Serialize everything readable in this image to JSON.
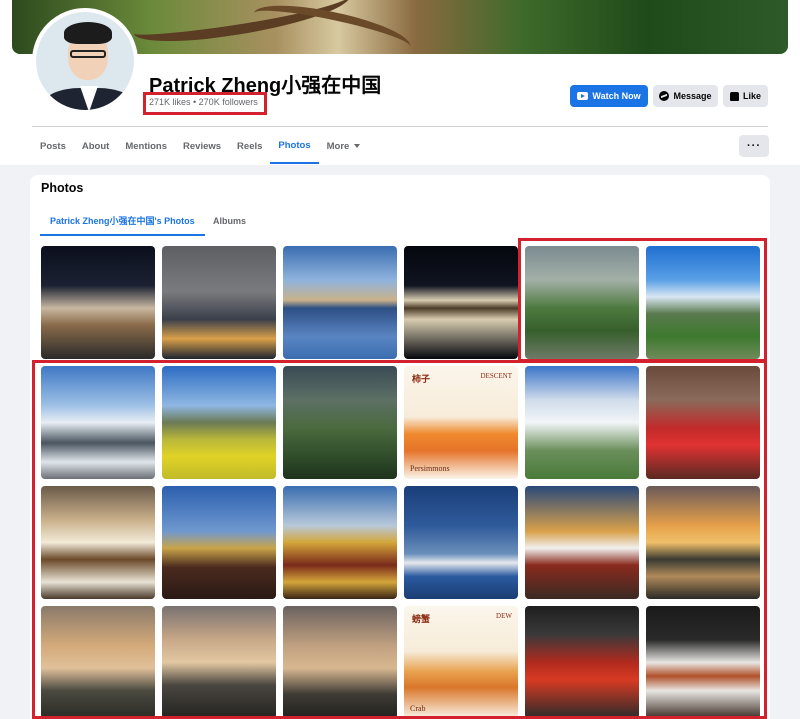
{
  "page": {
    "name": "Patrick Zheng小强在中国",
    "stats": "271K likes • 270K followers"
  },
  "actions": {
    "watch_label": "Watch Now",
    "message_label": "Message",
    "like_label": "Like"
  },
  "nav": {
    "tabs": [
      "Posts",
      "About",
      "Mentions",
      "Reviews",
      "Reels",
      "Photos",
      "More"
    ],
    "active": "Photos",
    "overflow_label": "···"
  },
  "photos": {
    "title": "Photos",
    "subtabs": [
      "Patrick Zheng小强在中国's Photos",
      "Albums"
    ],
    "items": [
      {
        "name": "potala-night-couple",
        "bg": "linear-gradient(180deg,#0b0f1c 0%,#1c2233 35%,#c8b8a0 55%,#8a6b4a 70%,#2a2a2a 100%)"
      },
      {
        "name": "city-skyline-night",
        "bg": "linear-gradient(180deg,#5e5f63 0%,#7a7b7e 40%,#3a3f4a 65%,#d9a04a 82%,#1e2430 100%)"
      },
      {
        "name": "person-sitting-reflection",
        "bg": "linear-gradient(180deg,#3a6db0 0%,#8fb3dd 30%,#c9b28a 48%,#2d4f84 55%,#5a85c2 80%,#3a6db0 100%)"
      },
      {
        "name": "potala-night-reflection",
        "bg": "linear-gradient(180deg,#05070d 0%,#0f1420 35%,#d8ccb0 48%,#4a3a28 55%,#d8ccb0 65%,#05070d 100%)"
      },
      {
        "name": "rainbow-valley",
        "bg": "linear-gradient(180deg,#7b8b8f 0%,#a3b0a8 30%,#4d7a3e 55%,#375f2c 75%,#6f7a68 100%)"
      },
      {
        "name": "mountain-village-blue-sky",
        "bg": "linear-gradient(180deg,#1f6fd1 0%,#5aa0e6 30%,#d8e6f2 45%,#5a7a4e 60%,#3d7a2e 80%,#6f8a5a 100%)"
      },
      {
        "name": "snowy-mountains",
        "bg": "linear-gradient(180deg,#3f78c4 0%,#9ec1e6 35%,#e8eef4 50%,#4a5560 68%,#dfe5ea 85%,#6a6f75 100%)"
      },
      {
        "name": "rapeseed-fields",
        "bg": "linear-gradient(180deg,#2d6cc4 0%,#8fb7e2 35%,#6b7a55 50%,#b9b83a 65%,#e0d226 80%,#c2bb2a 100%)"
      },
      {
        "name": "green-valley-clouds",
        "bg": "linear-gradient(180deg,#3a4a55 0%,#5c7065 30%,#4a6a3e 55%,#2f4d2a 80%,#1e331c 100%)"
      },
      {
        "name": "persimmons-poster",
        "bg": "linear-gradient(180deg,#fbf5ea 0%,#f7ecda 45%,#f08a2e 60%,#e5742a 75%,#fbf5ea 100%)",
        "title": "柿子",
        "tag": "DESCENT",
        "caption": "Persimmons"
      },
      {
        "name": "wind-turbines-clouds",
        "bg": "linear-gradient(180deg,#3b74c8 0%,#cfdcea 30%,#f2f5f8 50%,#6a8f5a 75%,#4a7a3a 100%)"
      },
      {
        "name": "red-lotus-lamp",
        "bg": "linear-gradient(180deg,#6a4a3a 0%,#8a6a5a 30%,#c22a2a 55%,#e03232 70%,#5a2a22 100%)"
      },
      {
        "name": "dessert-plate",
        "bg": "linear-gradient(180deg,#6a5a4a 0%,#c9b08a 30%,#f2ead8 50%,#6b4a2a 65%,#e8e2d4 85%,#4a3a2a 100%)"
      },
      {
        "name": "jokhang-roof",
        "bg": "linear-gradient(180deg,#2b5fae 0%,#6f98cf 40%,#c9a44a 55%,#4a2a1e 72%,#2a1a14 100%)"
      },
      {
        "name": "golden-temple-roof",
        "bg": "linear-gradient(180deg,#3a6db0 0%,#b8c9da 35%,#d4a63a 50%,#7a2a1a 70%,#d4a63a 85%,#3a2416 100%)"
      },
      {
        "name": "lake-mountains-blue",
        "bg": "linear-gradient(180deg,#1a3f7a 0%,#2f5a9a 35%,#6a8fba 60%,#e6e9ee 68%,#2a5aa0 80%,#1b3e72 100%)"
      },
      {
        "name": "potala-sunset",
        "bg": "linear-gradient(180deg,#2a4a7a 0%,#d8a04a 40%,#f0f0ee 55%,#8a2a1e 70%,#3a2a22 100%)"
      },
      {
        "name": "river-gorge-sunset",
        "bg": "linear-gradient(180deg,#6a5a5a 0%,#e6a04a 35%,#f0c06a 50%,#3a3a32 65%,#b08a5a 80%,#2a2a26 100%)"
      },
      {
        "name": "gorge-misty-sunset-1",
        "bg": "linear-gradient(180deg,#8a7a6a 0%,#d4aa7a 35%,#e0c09a 55%,#4a4a40 75%,#2a2a26 100%)"
      },
      {
        "name": "gorge-cliffs-sunset",
        "bg": "linear-gradient(180deg,#7a7270 0%,#c8a888 30%,#e2c8a2 50%,#4a4640 70%,#23221f 100%)"
      },
      {
        "name": "gorge-misty-sunset-2",
        "bg": "linear-gradient(180deg,#6a6260 0%,#c0a080 35%,#d8b890 55%,#3f3c36 78%,#22201d 100%)"
      },
      {
        "name": "crab-poster",
        "bg": "linear-gradient(180deg,#fbf6ec 0%,#f6ecd8 40%,#e9a250 58%,#d9762a 72%,#fbf6ec 100%)",
        "title": "螃蟹",
        "tag": "DEW",
        "caption": "Crab"
      },
      {
        "name": "mapo-tofu-bowl",
        "bg": "linear-gradient(180deg,#1e1e1e 0%,#3a3a3a 25%,#b02a1e 50%,#d83a22 65%,#2a2a2a 100%)"
      },
      {
        "name": "dish-on-plate",
        "bg": "linear-gradient(180deg,#1a1a1a 0%,#2a2a2a 30%,#e8e6e2 50%,#b0502a 62%,#e8e6e2 75%,#3a2a22 100%)"
      }
    ]
  },
  "colors": {
    "accent": "#1b74e4",
    "highlight": "#d3212d",
    "page_bg": "#f0f2f5"
  }
}
